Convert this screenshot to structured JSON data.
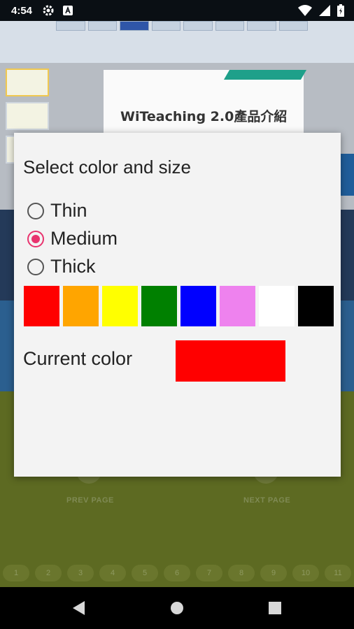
{
  "status_bar": {
    "time": "4:54",
    "icons": [
      "gear-icon",
      "a-letter-icon",
      "wifi-icon",
      "signal-icon",
      "battery-icon"
    ]
  },
  "background": {
    "slide_title": "WiTeaching 2.0產品介紹",
    "prev_page": "PREV PAGE",
    "next_page": "NEXT PAGE",
    "pages": [
      "1",
      "2",
      "3",
      "4",
      "5",
      "6",
      "7",
      "8",
      "9",
      "10",
      "11"
    ]
  },
  "dialog": {
    "title": "Select color and size",
    "sizes": [
      {
        "label": "Thin",
        "checked": false
      },
      {
        "label": "Medium",
        "checked": true
      },
      {
        "label": "Thick",
        "checked": false
      }
    ],
    "colors": [
      "#ff0000",
      "#ffa500",
      "#ffff00",
      "#008000",
      "#0000ff",
      "#ee82ee",
      "#ffffff",
      "#000000"
    ],
    "current_label": "Current color",
    "current_color": "#ff0000"
  }
}
